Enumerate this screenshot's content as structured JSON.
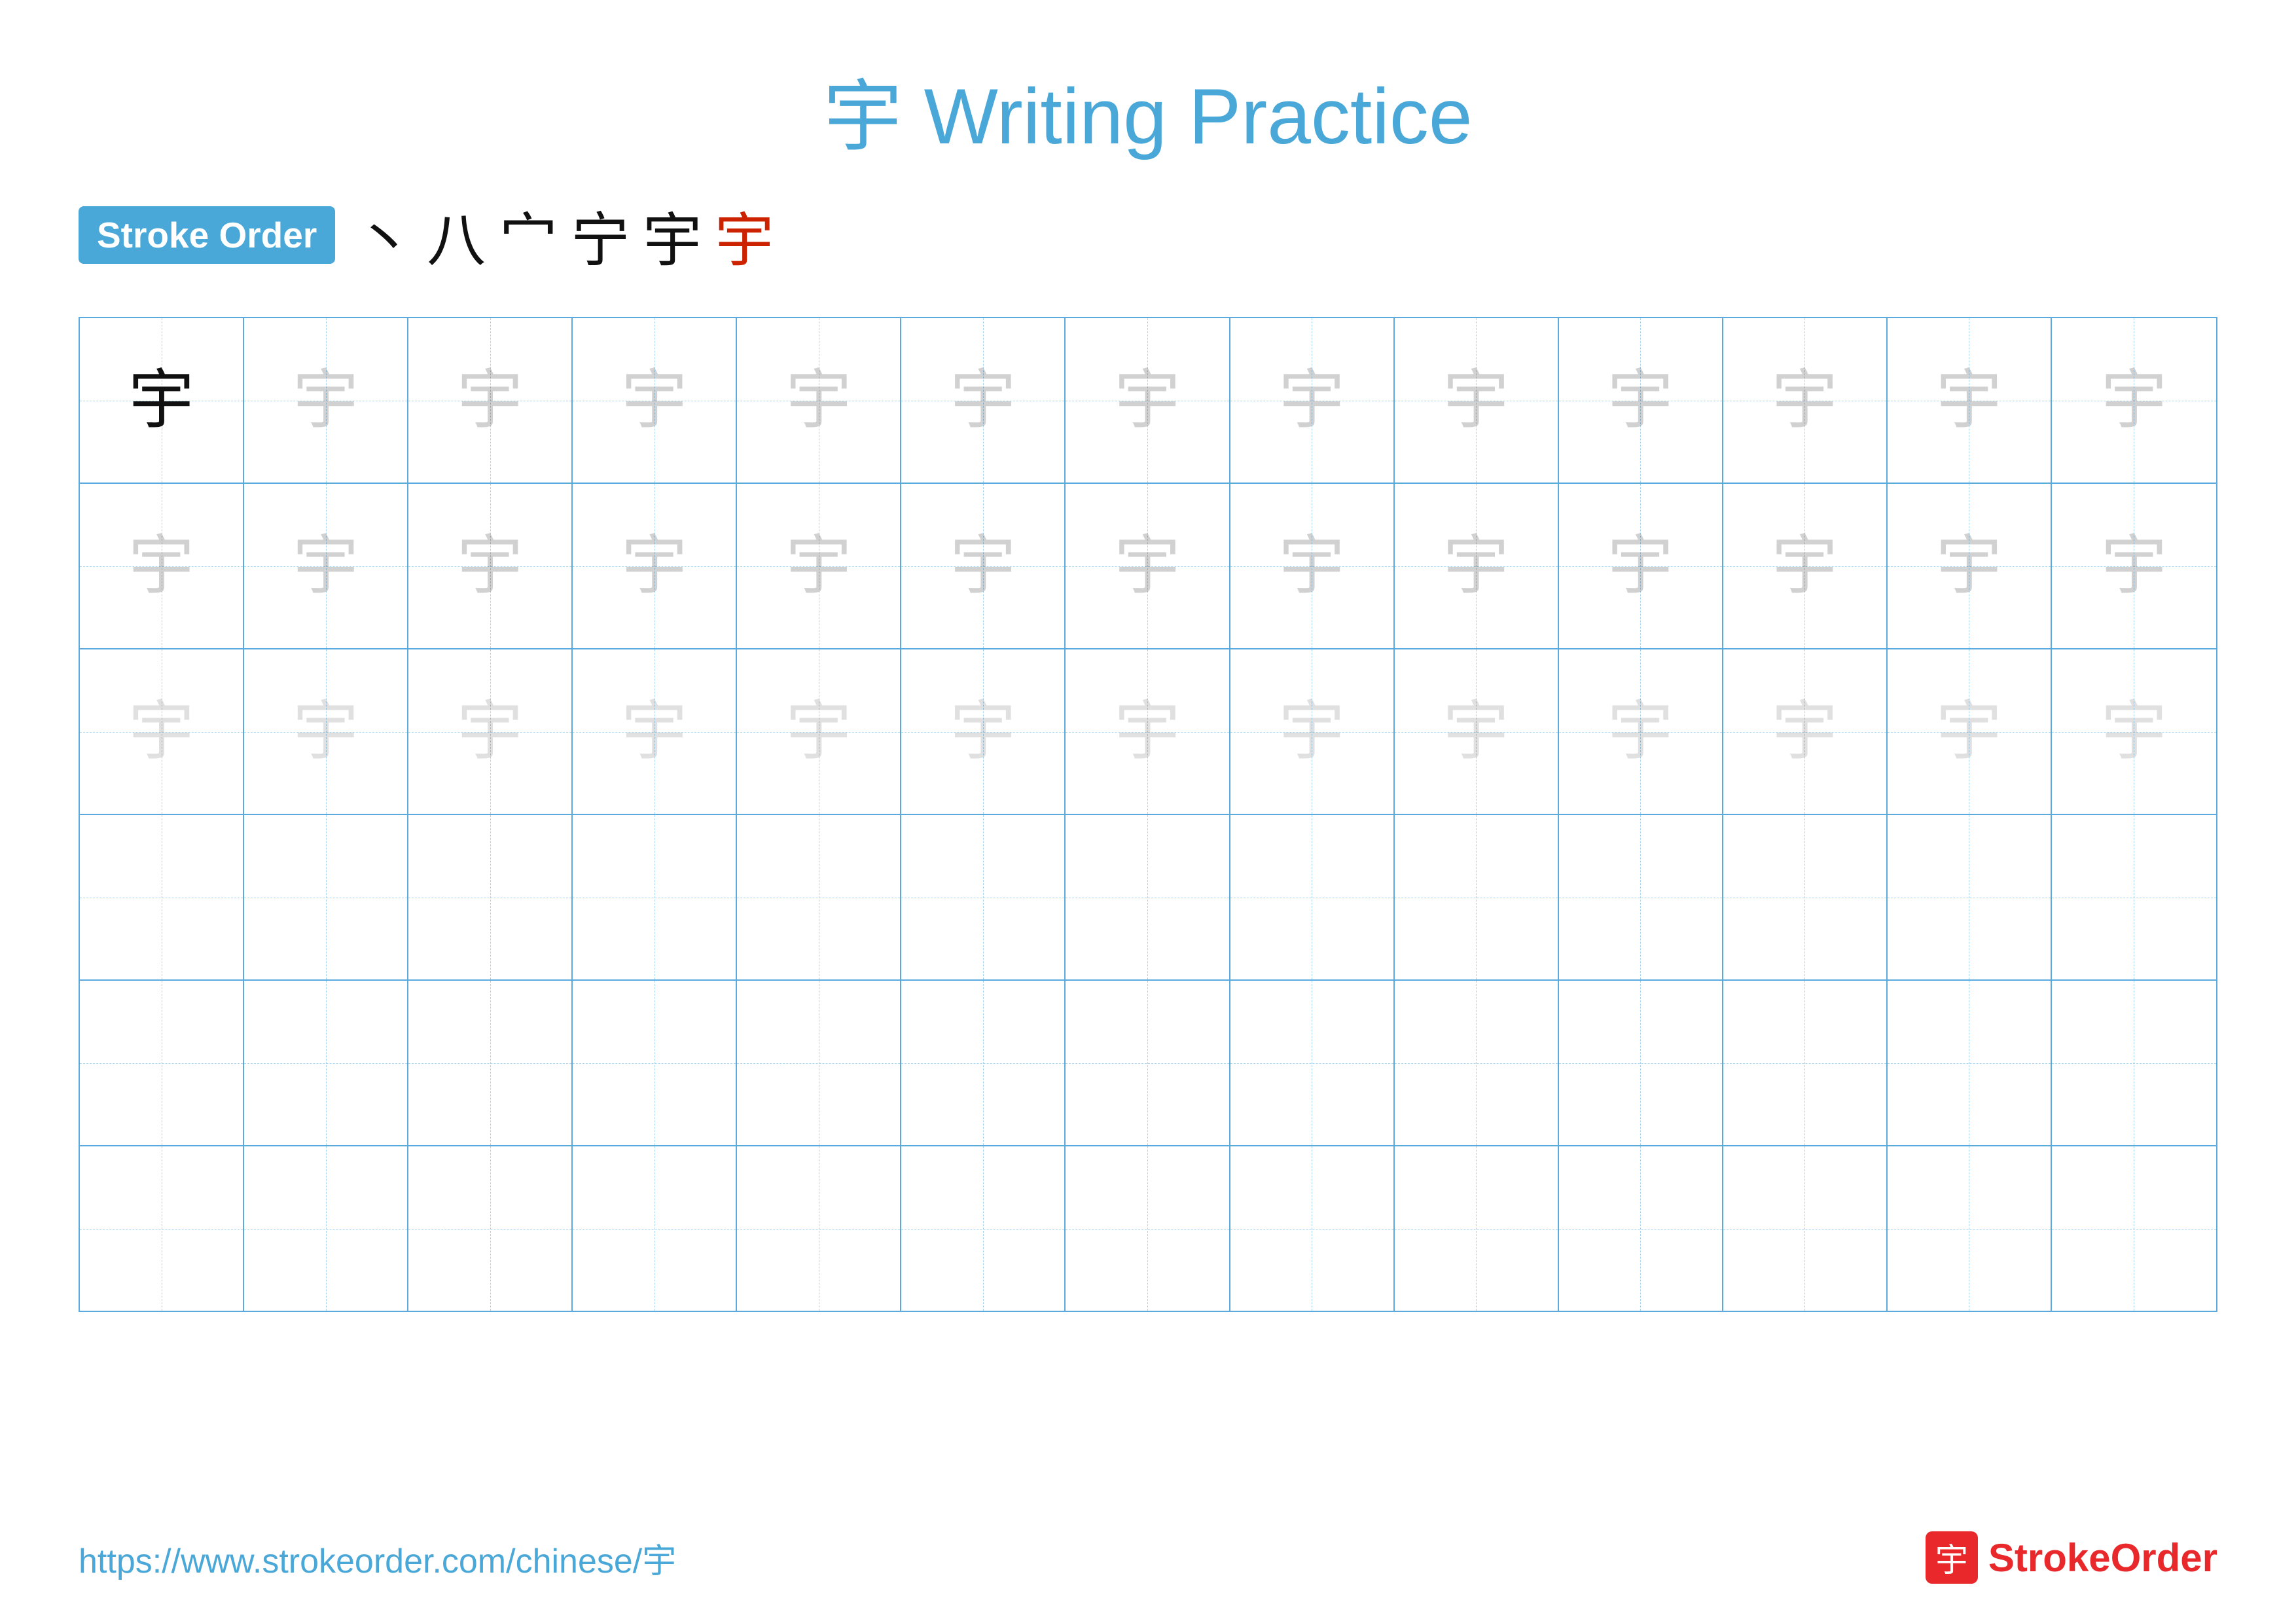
{
  "title": {
    "char": "宇",
    "label": "Writing Practice",
    "full": "宇 Writing Practice"
  },
  "stroke_order": {
    "badge_label": "Stroke Order",
    "strokes": [
      "丶",
      "八",
      "宀",
      "宁",
      "宇",
      "宇"
    ],
    "stroke_colors": [
      "black",
      "black",
      "black",
      "black",
      "black",
      "red"
    ]
  },
  "grid": {
    "rows": 6,
    "cols": 13,
    "char": "宇",
    "filled_rows": 3,
    "row_opacities": [
      "solid",
      "light1",
      "light2",
      "empty",
      "empty",
      "empty"
    ]
  },
  "footer": {
    "url": "https://www.strokeorder.com/chinese/宇",
    "logo_char": "宇",
    "logo_name": "StrokeOrder",
    "logo_name_colored": "Stroke",
    "logo_name_plain": "Order"
  }
}
